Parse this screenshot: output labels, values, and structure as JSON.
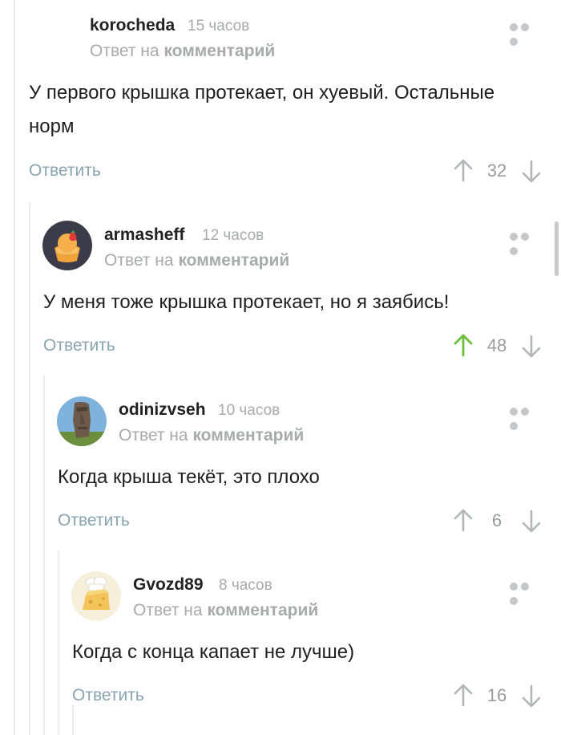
{
  "comments": [
    {
      "username": "korocheda",
      "time": "15 часов",
      "reply_prefix": "Ответ на",
      "reply_link": "комментарий",
      "text": "У первого крышка протекает, он хуевый. Остальные норм",
      "reply_label": "Ответить",
      "rating": "32",
      "upvoted": false,
      "avatar_icon": "none"
    },
    {
      "username": "armasheff",
      "time": "12 часов",
      "reply_prefix": "Ответ на",
      "reply_link": "комментарий",
      "text": "У меня тоже крышка протекает, но я заябись!",
      "reply_label": "Ответить",
      "rating": "48",
      "upvoted": true,
      "avatar_icon": "cupcake"
    },
    {
      "username": "odinizvseh",
      "time": "10 часов",
      "reply_prefix": "Ответ на",
      "reply_link": "комментарий",
      "text": "Когда крыша текёт, это плохо",
      "reply_label": "Ответить",
      "rating": "6",
      "upvoted": false,
      "avatar_icon": "moai-statue"
    },
    {
      "username": "Gvozd89",
      "time": "8 часов",
      "reply_prefix": "Ответ на",
      "reply_link": "комментарий",
      "text": "Когда с конца капает не лучше)",
      "reply_label": "Ответить",
      "rating": "16",
      "upvoted": false,
      "avatar_icon": "cheese-chef"
    }
  ],
  "colors": {
    "upvote_active": "#6bbf3a",
    "icon_gray": "#b3b6b9",
    "reply_link": "#8aa5b0",
    "meta_gray": "#a9aaab"
  }
}
